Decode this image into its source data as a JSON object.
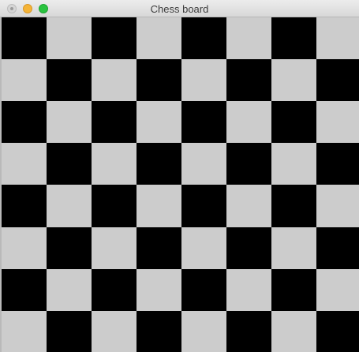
{
  "window": {
    "title": "Chess board"
  },
  "board": {
    "rows": 8,
    "cols": 8,
    "first_square_color": "dark",
    "colors": {
      "dark": "#000000",
      "light": "#cccccc"
    }
  },
  "colors": {
    "close": "#d6d6d6",
    "minimize": "#f5b437",
    "zoom": "#29c33f"
  }
}
